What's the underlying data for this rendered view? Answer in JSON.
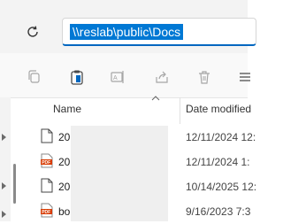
{
  "address_bar": {
    "path": "\\\\reslab\\public\\Docs"
  },
  "toolbar": {
    "icons": [
      "copy-icon",
      "clipboard-paste-icon",
      "rename-icon",
      "share-icon",
      "delete-icon"
    ]
  },
  "file_list": {
    "columns": {
      "name": "Name",
      "date": "Date modified"
    },
    "rows": [
      {
        "icon": "document-icon",
        "name": "20",
        "date": "12/11/2024 12:"
      },
      {
        "icon": "pdf-icon",
        "name": "20",
        "date": "12/11/2024 1:"
      },
      {
        "icon": "document-icon",
        "name": "20",
        "date": "10/14/2025 12:"
      },
      {
        "icon": "pdf-icon",
        "name": "bo",
        "date": "9/16/2023 7:3"
      }
    ]
  },
  "colors": {
    "selection": "#0078d4",
    "pdf_red": "#d83b01",
    "toolbar_icon": "#a6a6a6"
  }
}
